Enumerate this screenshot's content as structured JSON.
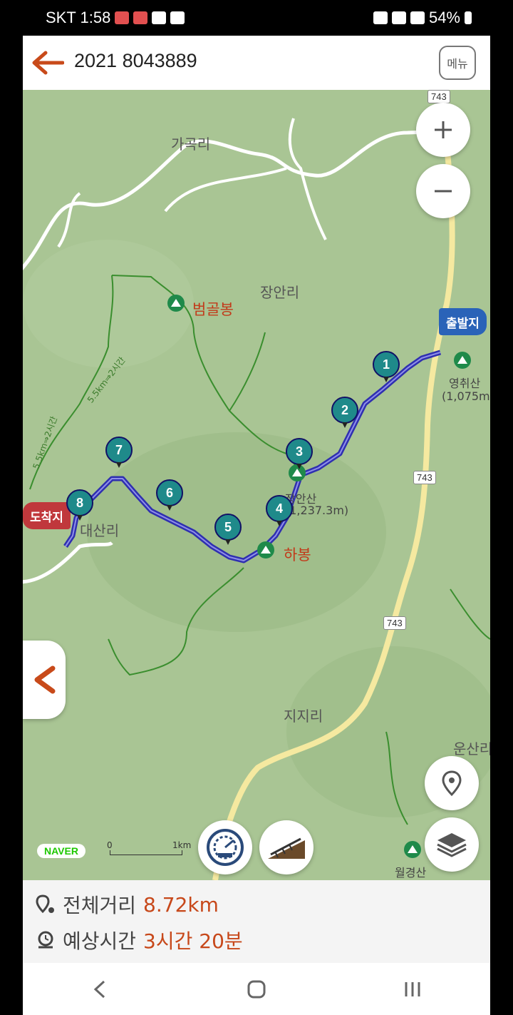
{
  "status": {
    "carrier_time": "SKT 1:58",
    "battery": "54%"
  },
  "header": {
    "title": "2021 8043889",
    "menu_label": "메뉴"
  },
  "map": {
    "villages": [
      "가곡리",
      "장안리",
      "지지리",
      "운산리",
      "대산리"
    ],
    "peaks": [
      {
        "name": "범골봉"
      },
      {
        "name": "하봉"
      },
      {
        "name": "장안산",
        "elev": "(1,237.3m)"
      },
      {
        "name": "영취산",
        "elev": "(1,075m)"
      },
      {
        "name": "월경산"
      }
    ],
    "road_number": "743",
    "trail_label": "5.5km⇒2시간",
    "start_label": "출발지",
    "end_label": "도착지",
    "waypoints": [
      "1",
      "2",
      "3",
      "4",
      "5",
      "6",
      "7",
      "8"
    ],
    "naver": "NAVER",
    "scale_min": "0",
    "scale_max": "1km",
    "colors": {
      "route": "#3d3dc8",
      "marker": "#1f8a8a",
      "accent": "#c7481a",
      "terrain": "#a9c594"
    }
  },
  "summary": {
    "distance_label": "전체거리",
    "distance_value": "8.72km",
    "time_label": "예상시간",
    "time_value": "3시간 20분"
  }
}
